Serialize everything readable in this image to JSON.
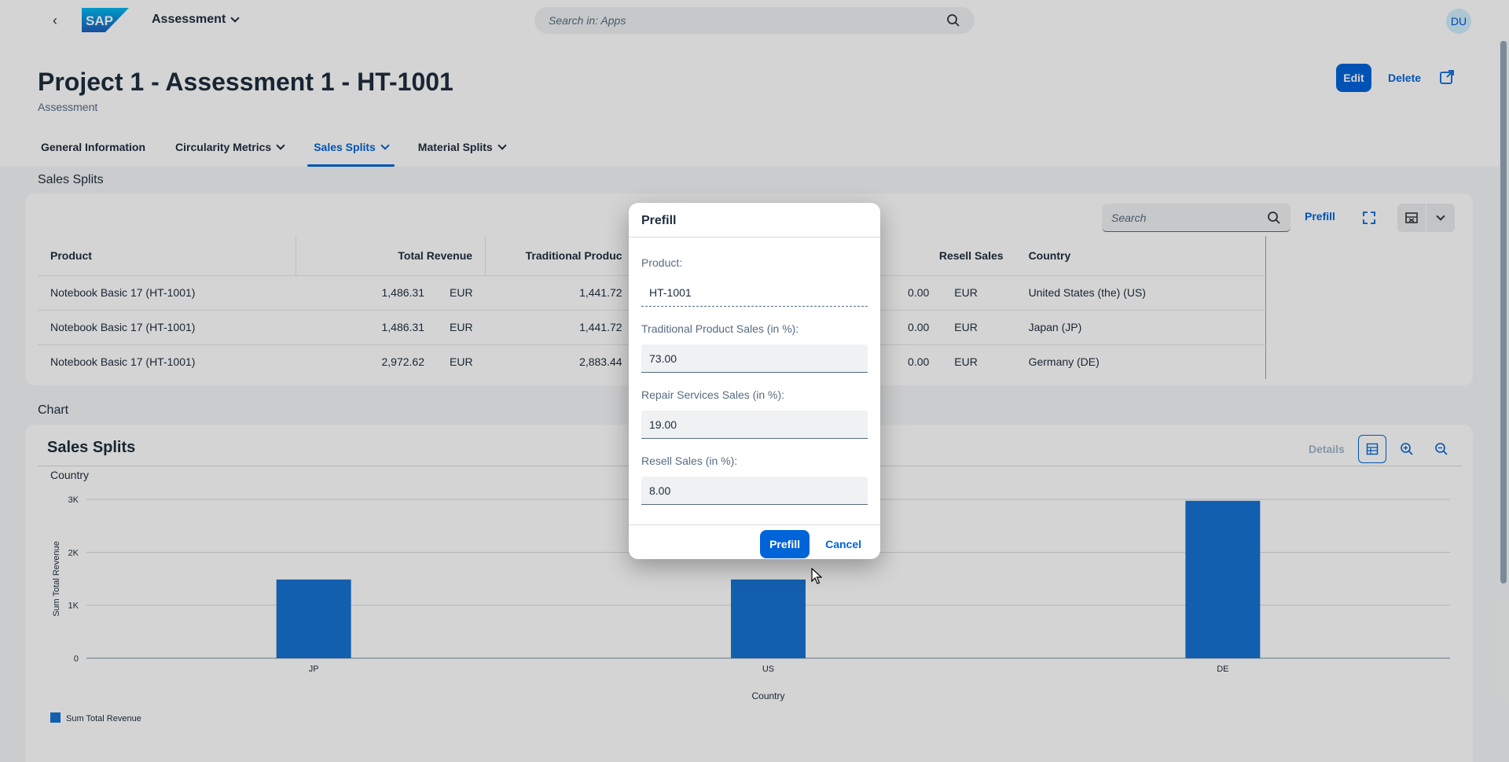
{
  "shell": {
    "app_title": "Assessment",
    "search_placeholder": "Search in: Apps",
    "avatar_initials": "DU",
    "logo_text": "SAP"
  },
  "header": {
    "title": "Project 1 - Assessment 1 - HT-1001",
    "subtitle": "Assessment",
    "edit_label": "Edit",
    "delete_label": "Delete"
  },
  "tabs": [
    {
      "label": "General Information"
    },
    {
      "label": "Circularity Metrics"
    },
    {
      "label": "Sales Splits"
    },
    {
      "label": "Material Splits"
    }
  ],
  "sales_section": {
    "title": "Sales Splits",
    "search_placeholder": "Search",
    "prefill_label": "Prefill",
    "columns": [
      "Product",
      "Total Revenue",
      "Traditional Produc",
      "Resell Sales",
      "Country"
    ],
    "rows": [
      {
        "product": "Notebook Basic 17 (HT-1001)",
        "total": "1,486.31",
        "total_cur": "EUR",
        "trad": "1,441.72",
        "resell": "0.00",
        "resell_cur": "EUR",
        "country": "United States (the) (US)"
      },
      {
        "product": "Notebook Basic 17 (HT-1001)",
        "total": "1,486.31",
        "total_cur": "EUR",
        "trad": "1,441.72",
        "resell": "0.00",
        "resell_cur": "EUR",
        "country": "Japan (JP)"
      },
      {
        "product": "Notebook Basic 17 (HT-1001)",
        "total": "2,972.62",
        "total_cur": "EUR",
        "trad": "2,883.44",
        "resell": "0.00",
        "resell_cur": "EUR",
        "country": "Germany (DE)"
      }
    ]
  },
  "chart_section": {
    "section_title": "Chart",
    "card_title": "Sales Splits",
    "details_label": "Details",
    "dimension_label": "Country"
  },
  "chart_data": {
    "type": "bar",
    "title": "Sales Splits",
    "categories": [
      "JP",
      "US",
      "DE"
    ],
    "series": [
      {
        "name": "Sum Total Revenue",
        "values": [
          1486.31,
          1486.31,
          2972.62
        ]
      }
    ],
    "xlabel": "Country",
    "ylabel": "Sum Total Revenue",
    "ylim": [
      0,
      3000
    ],
    "yticks": [
      "0",
      "1K",
      "2K",
      "3K"
    ],
    "grid": true,
    "legend": "bottom-left",
    "color": "#1873d3"
  },
  "dialog": {
    "title": "Prefill",
    "product_label": "Product:",
    "product_value": "HT-1001",
    "trad_label": "Traditional Product Sales (in %):",
    "trad_value": "73.00",
    "repair_label": "Repair Services Sales (in %):",
    "repair_value": "19.00",
    "resell_label": "Resell Sales (in %):",
    "resell_value": "8.00",
    "prefill_button": "Prefill",
    "cancel_button": "Cancel"
  },
  "colors": {
    "accent": "#0064d9",
    "bar": "#1873d3"
  }
}
